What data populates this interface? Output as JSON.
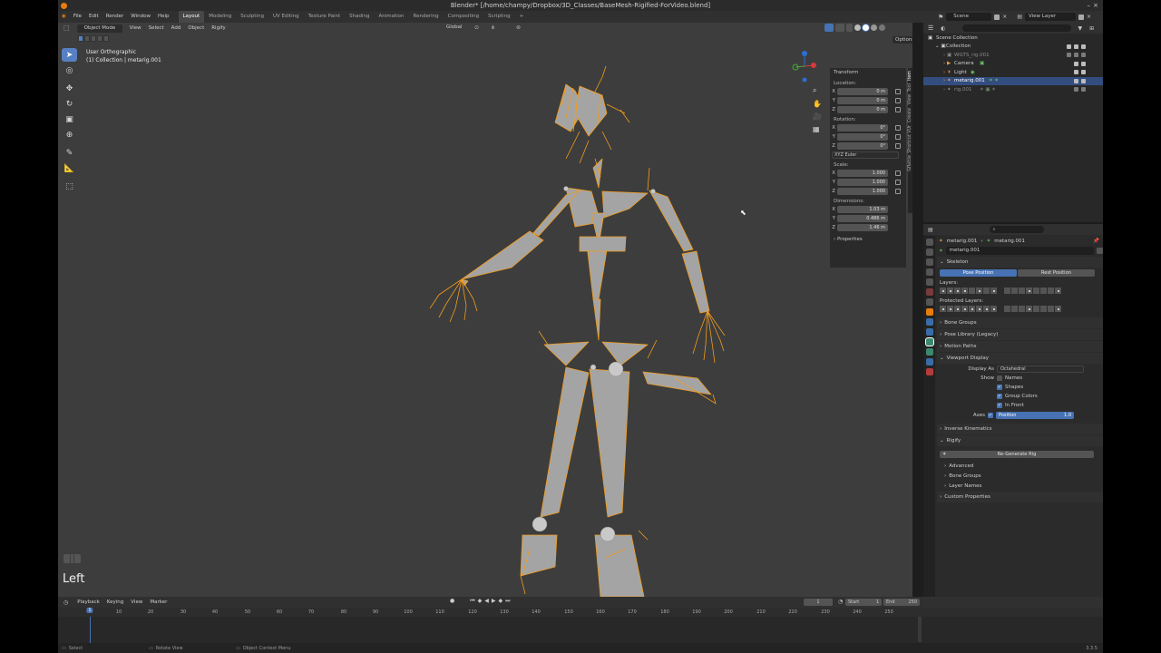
{
  "window": {
    "title": "Blender* [/home/champy/Dropbox/3D_Classes/BaseMesh-Rigified-ForVideo.blend]"
  },
  "menus": [
    "File",
    "Edit",
    "Render",
    "Window",
    "Help"
  ],
  "workspaces": [
    "Layout",
    "Modeling",
    "Sculpting",
    "UV Editing",
    "Texture Paint",
    "Shading",
    "Animation",
    "Rendering",
    "Compositing",
    "Scripting"
  ],
  "topbar_right": {
    "scene": "Scene",
    "view_layer": "View Layer"
  },
  "viewport": {
    "mode": "Object Mode",
    "menus": [
      "View",
      "Select",
      "Add",
      "Object",
      "Rigify"
    ],
    "orientation": "Global",
    "options_label": "Options",
    "view_name": "User Orthographic",
    "collection_info": "(1) Collection | metarig.001",
    "key_overlay": "Left"
  },
  "npanel": {
    "title": "Transform",
    "location_label": "Location:",
    "location": [
      {
        "axis": "X",
        "value": "0 m"
      },
      {
        "axis": "Y",
        "value": "0 m"
      },
      {
        "axis": "Z",
        "value": "0 m"
      }
    ],
    "rotation_label": "Rotation:",
    "rotation": [
      {
        "axis": "X",
        "value": "0°"
      },
      {
        "axis": "Y",
        "value": "0°"
      },
      {
        "axis": "Z",
        "value": "0°"
      }
    ],
    "rotation_mode": "XYZ Euler",
    "scale_label": "Scale:",
    "scale": [
      {
        "axis": "X",
        "value": "1.000"
      },
      {
        "axis": "Y",
        "value": "1.000"
      },
      {
        "axis": "Z",
        "value": "1.000"
      }
    ],
    "dimensions_label": "Dimensions:",
    "dimensions": [
      {
        "axis": "X",
        "value": "1.03 m"
      },
      {
        "axis": "Y",
        "value": "0.486 m"
      },
      {
        "axis": "Z",
        "value": "1.46 m"
      }
    ],
    "properties_label": "Properties",
    "side_tabs": [
      "Item",
      "Tool",
      "View",
      "Create",
      "Shortcut VUr",
      "Gflattie"
    ]
  },
  "outliner": {
    "rows": [
      {
        "name": "Scene Collection",
        "indent": 0,
        "selected": false,
        "dim": false
      },
      {
        "name": "Collection",
        "indent": 1,
        "selected": false,
        "dim": false
      },
      {
        "name": "WGTS_rig.001",
        "indent": 2,
        "selected": false,
        "dim": true
      },
      {
        "name": "Camera",
        "indent": 2,
        "selected": false,
        "dim": false
      },
      {
        "name": "Light",
        "indent": 2,
        "selected": false,
        "dim": false
      },
      {
        "name": "metarig.001",
        "indent": 2,
        "selected": true,
        "dim": false
      },
      {
        "name": "rig.001",
        "indent": 2,
        "selected": false,
        "dim": true
      }
    ]
  },
  "properties": {
    "breadcrumb": [
      "metarig.001",
      "metarig.001"
    ],
    "data_name": "metarig.001",
    "skeleton": "Skeleton",
    "pose_position": "Pose Position",
    "rest_position": "Rest Position",
    "layers_label": "Layers:",
    "protected_label": "Protected Layers:",
    "bone_groups": "Bone Groups",
    "pose_library": "Pose Library (Legacy)",
    "motion_paths": "Motion Paths",
    "viewport_display": "Viewport Display",
    "display_as_label": "Display As",
    "display_as_value": "Octahedral",
    "show_label": "Show",
    "show_options": [
      {
        "label": "Names",
        "checked": false
      },
      {
        "label": "Shapes",
        "checked": true
      },
      {
        "label": "Group Colors",
        "checked": true
      },
      {
        "label": "In Front",
        "checked": true
      }
    ],
    "axes_label": "Axes",
    "axes_position_label": "Position",
    "axes_position_value": "1.0",
    "inverse_kinematics": "Inverse Kinematics",
    "rigify": "Rigify",
    "regenerate": "Re-Generate Rig",
    "advanced": "Advanced",
    "rigify_bone_groups": "Bone Groups",
    "layer_names": "Layer Names",
    "custom_properties": "Custom Properties"
  },
  "timeline": {
    "menus": [
      "Playback",
      "Keying",
      "View",
      "Marker"
    ],
    "current_frame": "1",
    "start_label": "Start",
    "start": "1",
    "end_label": "End",
    "end": "250",
    "ticks": [
      "1",
      "10",
      "20",
      "30",
      "40",
      "50",
      "60",
      "70",
      "80",
      "90",
      "100",
      "110",
      "120",
      "130",
      "140",
      "150",
      "160",
      "170",
      "180",
      "190",
      "200",
      "210",
      "220",
      "230",
      "240",
      "250"
    ]
  },
  "statusbar": {
    "select": "Select",
    "rotate": "Rotate View",
    "context": "Object Context Menu",
    "version": "3.3.5"
  },
  "colors": {
    "accent": "#4772b3",
    "bone_select": "#f39c1b",
    "bone_fill": "#a4a4a4",
    "viewport_bg": "#3d3d3d"
  }
}
